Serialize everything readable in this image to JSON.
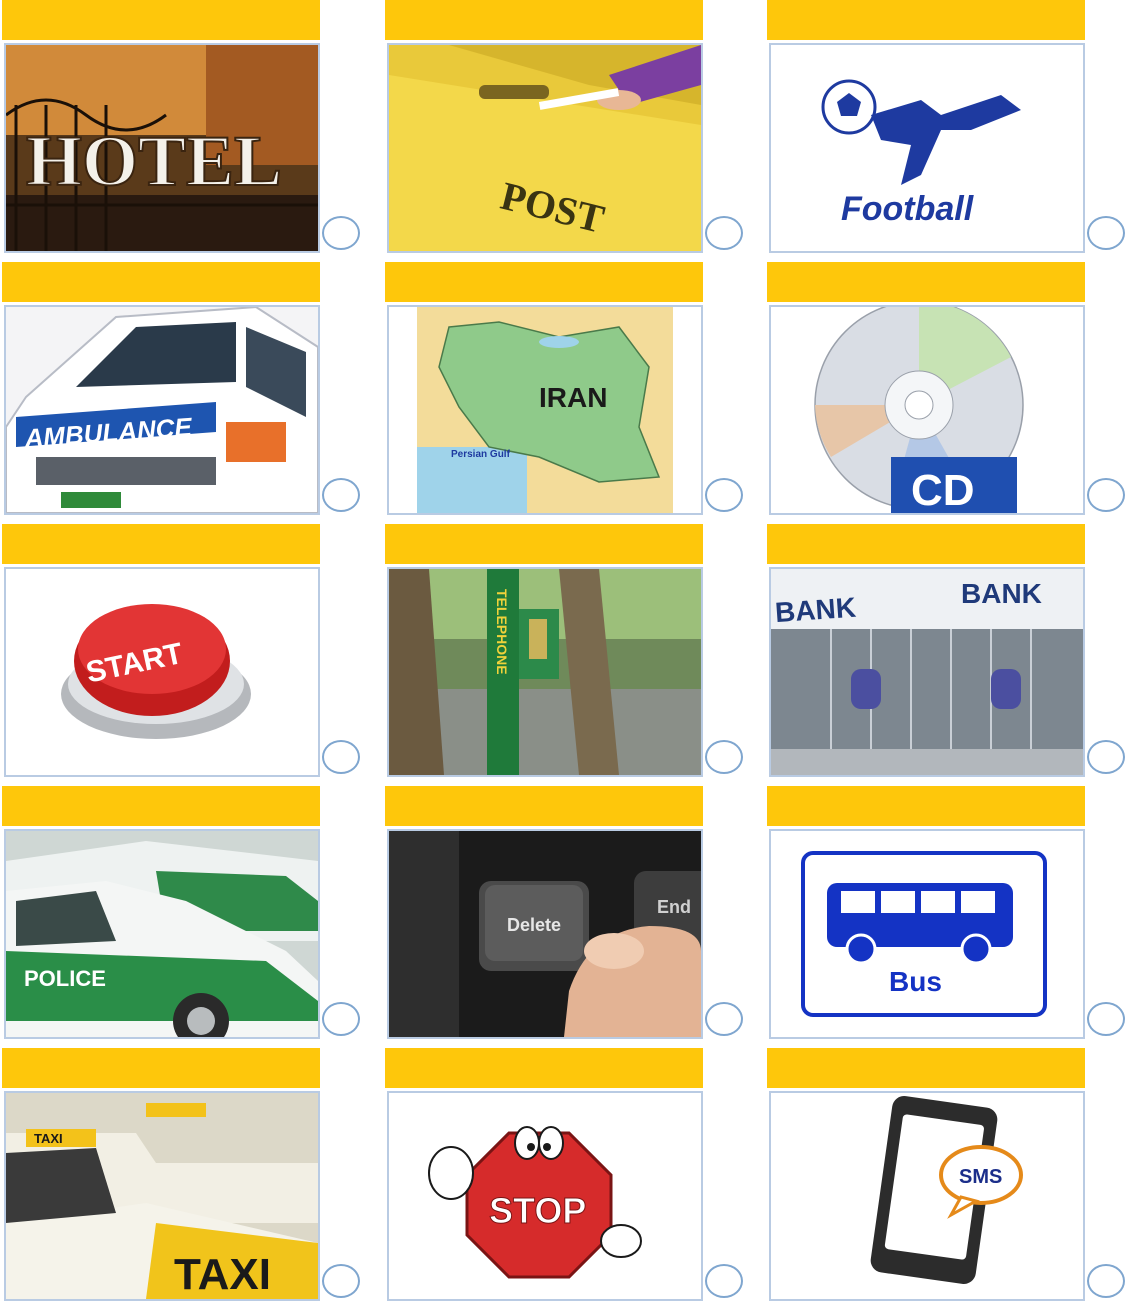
{
  "cards": [
    {
      "id": "hotel",
      "label": "HOTEL"
    },
    {
      "id": "post",
      "label": "POST"
    },
    {
      "id": "football",
      "label": "Football"
    },
    {
      "id": "ambulance",
      "label": "AMBULANCE"
    },
    {
      "id": "iran",
      "label": "IRAN"
    },
    {
      "id": "cd",
      "label": "CD"
    },
    {
      "id": "start",
      "label": "START"
    },
    {
      "id": "telephone",
      "label": "TELEPHONE"
    },
    {
      "id": "bank",
      "label": "BANK"
    },
    {
      "id": "police",
      "label": "POLICE"
    },
    {
      "id": "delete",
      "label": "Delete"
    },
    {
      "id": "bus",
      "label": "Bus"
    },
    {
      "id": "taxi",
      "label": "TAXI"
    },
    {
      "id": "stop",
      "label": "STOP"
    },
    {
      "id": "sms",
      "label": "SMS"
    }
  ],
  "map_labels": {
    "gulf": "Persian Gulf"
  },
  "keyboard": {
    "end_key": "End"
  },
  "colors": {
    "title_bar": "#fec70b",
    "frame_border": "#b9cbe3",
    "circle_border": "#7fa6cf"
  }
}
